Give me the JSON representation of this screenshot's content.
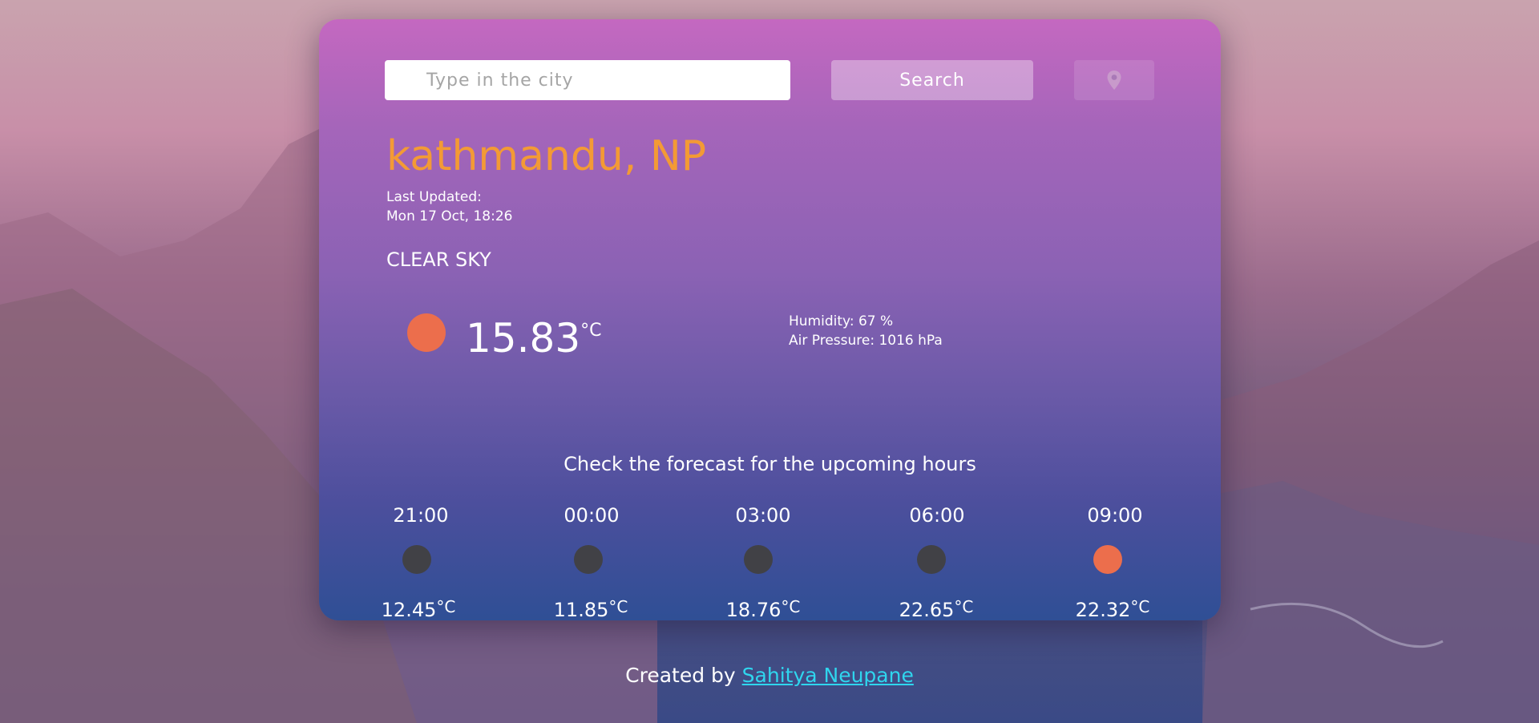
{
  "search": {
    "placeholder": "Type in the city",
    "button_label": "Search",
    "location_icon": "location-pin-icon"
  },
  "current": {
    "city": "kathmandu, NP",
    "updated_label": "Last Updated:",
    "updated_time": "Mon 17 Oct, 18:26",
    "description": "CLEAR SKY",
    "icon": "sun-icon",
    "icon_color": "#ec6e4c",
    "temperature": "15.83",
    "unit": "°C",
    "humidity": "Humidity: 67 %",
    "pressure": "Air Pressure: 1016 hPa"
  },
  "forecast": {
    "title": "Check the forecast for the upcoming hours",
    "items": [
      {
        "time": "21:00",
        "temp": "12.45",
        "unit": "°C",
        "icon": "moon-icon",
        "icon_color": "#414146"
      },
      {
        "time": "00:00",
        "temp": "11.85",
        "unit": "°C",
        "icon": "moon-icon",
        "icon_color": "#414146"
      },
      {
        "time": "03:00",
        "temp": "18.76",
        "unit": "°C",
        "icon": "moon-icon",
        "icon_color": "#414146"
      },
      {
        "time": "06:00",
        "temp": "22.65",
        "unit": "°C",
        "icon": "moon-icon",
        "icon_color": "#414146"
      },
      {
        "time": "09:00",
        "temp": "22.32",
        "unit": "°C",
        "icon": "sun-icon",
        "icon_color": "#ec6e4c"
      }
    ]
  },
  "footer": {
    "prefix": "Created by",
    "author": "Sahitya Neupane"
  },
  "colors": {
    "city": "#f39a35",
    "link": "#2fd6ee",
    "card_top": "#c468c0",
    "card_bottom": "#2f4f95"
  }
}
